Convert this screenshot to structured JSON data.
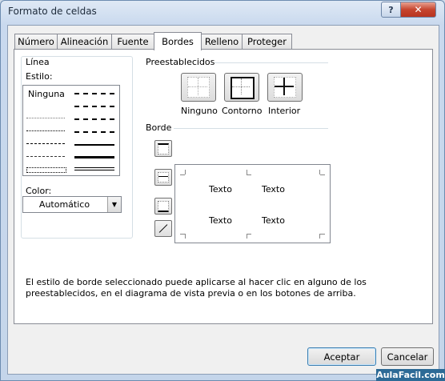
{
  "window": {
    "title": "Formato de celdas",
    "help_label": "?",
    "close_label": "✕"
  },
  "tabs": [
    {
      "label": "Número"
    },
    {
      "label": "Alineación"
    },
    {
      "label": "Fuente"
    },
    {
      "label": "Bordes",
      "active": true
    },
    {
      "label": "Relleno"
    },
    {
      "label": "Proteger"
    }
  ],
  "line_group": {
    "title": "Línea",
    "style_label": "Estilo:",
    "none_label": "Ninguna",
    "color_label": "Color:",
    "color_value": "Automático"
  },
  "presets": {
    "title": "Preestablecidos",
    "buttons": [
      {
        "label": "Ninguno"
      },
      {
        "label": "Contorno"
      },
      {
        "label": "Interior"
      }
    ]
  },
  "border": {
    "title": "Borde",
    "preview_texts": [
      "Texto",
      "Texto",
      "Texto",
      "Texto"
    ]
  },
  "description": "El estilo de borde seleccionado puede aplicarse al hacer clic en alguno de los preestablecidos, en el diagrama de vista previa o en los botones de arriba.",
  "buttons": {
    "accept": "Aceptar",
    "cancel": "Cancelar"
  },
  "watermark": "AulaFacil.com",
  "colors": {
    "title_bg": "#c9d9ee",
    "close_red": "#c6452f",
    "dialog_bg": "#f0f0f0",
    "accent_blue": "#3c7fb1"
  }
}
